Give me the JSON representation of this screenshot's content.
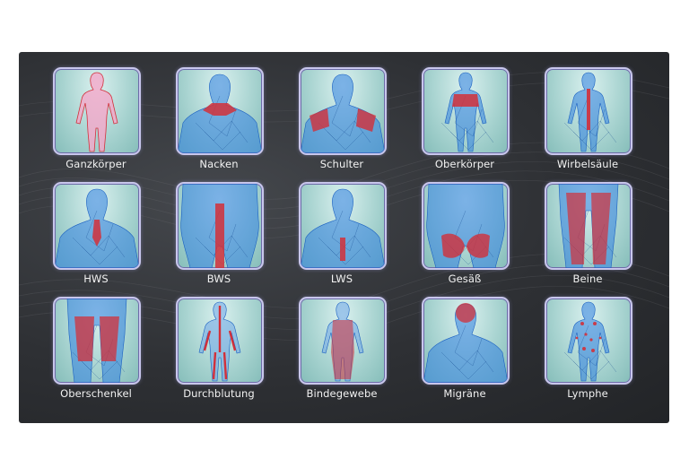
{
  "colors": {
    "panel": "#2e3034",
    "frame": "#c8c6ec",
    "body": "#2f7fe0",
    "highlight": "#d2303a",
    "label": "#f2f2f2"
  },
  "tiles": [
    {
      "label": "Ganzkörper",
      "icon": "full-body-icon"
    },
    {
      "label": "Nacken",
      "icon": "neck-icon"
    },
    {
      "label": "Schulter",
      "icon": "shoulder-icon"
    },
    {
      "label": "Oberkörper",
      "icon": "upper-body-icon"
    },
    {
      "label": "Wirbelsäule",
      "icon": "spine-icon"
    },
    {
      "label": "HWS",
      "icon": "cervical-spine-icon"
    },
    {
      "label": "BWS",
      "icon": "thoracic-spine-icon"
    },
    {
      "label": "LWS",
      "icon": "lumbar-spine-icon"
    },
    {
      "label": "Gesäß",
      "icon": "buttocks-icon"
    },
    {
      "label": "Beine",
      "icon": "legs-icon"
    },
    {
      "label": "Oberschenkel",
      "icon": "thighs-icon"
    },
    {
      "label": "Durchblutung",
      "icon": "circulation-icon"
    },
    {
      "label": "Bindegewebe",
      "icon": "connective-tissue-icon"
    },
    {
      "label": "Migräne",
      "icon": "migraine-icon"
    },
    {
      "label": "Lymphe",
      "icon": "lymph-icon"
    }
  ]
}
